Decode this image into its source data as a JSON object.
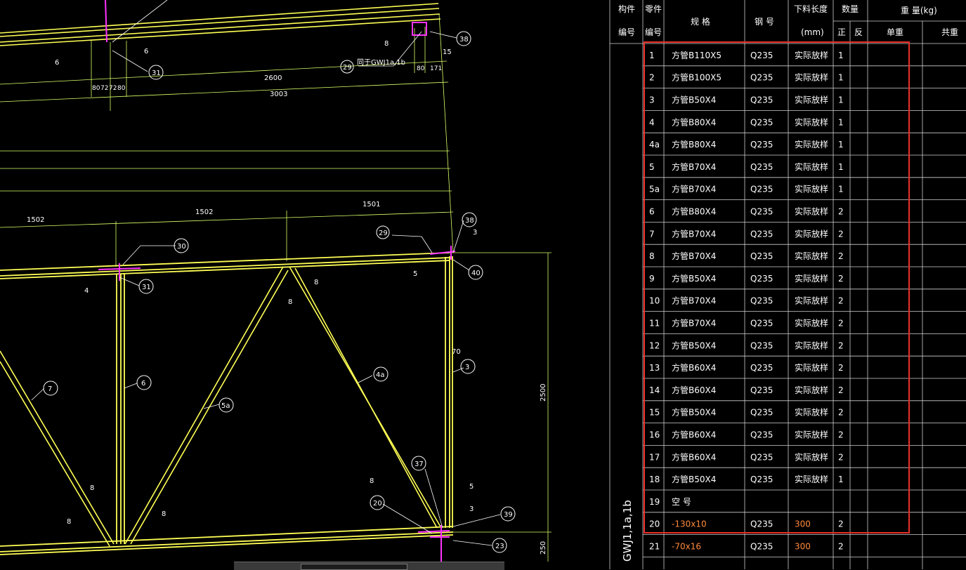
{
  "table": {
    "header": {
      "member_no": [
        "构件",
        "编号"
      ],
      "part_no": [
        "零件",
        "编号"
      ],
      "spec": "规  格",
      "steel": "钢  号",
      "cut_length": [
        "下料长度",
        "(mm)"
      ],
      "quantity": "数量",
      "qty_front": "正",
      "qty_back": "反",
      "weight": "重  量(kg)",
      "unit_weight": "单重",
      "total_weight": "共重"
    },
    "member_id": "GWJ1,1a,1b",
    "rows": [
      {
        "no": "1",
        "spec": "方管B110X5",
        "steel": "Q235",
        "length": "实际放样",
        "qty": "1"
      },
      {
        "no": "2",
        "spec": "方管B100X5",
        "steel": "Q235",
        "length": "实际放样",
        "qty": "1"
      },
      {
        "no": "3",
        "spec": "方管B50X4",
        "steel": "Q235",
        "length": "实际放样",
        "qty": "1"
      },
      {
        "no": "4",
        "spec": "方管B80X4",
        "steel": "Q235",
        "length": "实际放样",
        "qty": "1"
      },
      {
        "no": "4a",
        "spec": "方管B80X4",
        "steel": "Q235",
        "length": "实际放样",
        "qty": "1"
      },
      {
        "no": "5",
        "spec": "方管B70X4",
        "steel": "Q235",
        "length": "实际放样",
        "qty": "1"
      },
      {
        "no": "5a",
        "spec": "方管B70X4",
        "steel": "Q235",
        "length": "实际放样",
        "qty": "1"
      },
      {
        "no": "6",
        "spec": "方管B80X4",
        "steel": "Q235",
        "length": "实际放样",
        "qty": "2"
      },
      {
        "no": "7",
        "spec": "方管B70X4",
        "steel": "Q235",
        "length": "实际放样",
        "qty": "2"
      },
      {
        "no": "8",
        "spec": "方管B70X4",
        "steel": "Q235",
        "length": "实际放样",
        "qty": "2"
      },
      {
        "no": "9",
        "spec": "方管B50X4",
        "steel": "Q235",
        "length": "实际放样",
        "qty": "2"
      },
      {
        "no": "10",
        "spec": "方管B70X4",
        "steel": "Q235",
        "length": "实际放样",
        "qty": "2"
      },
      {
        "no": "11",
        "spec": "方管B70X4",
        "steel": "Q235",
        "length": "实际放样",
        "qty": "2"
      },
      {
        "no": "12",
        "spec": "方管B50X4",
        "steel": "Q235",
        "length": "实际放样",
        "qty": "2"
      },
      {
        "no": "13",
        "spec": "方管B60X4",
        "steel": "Q235",
        "length": "实际放样",
        "qty": "2"
      },
      {
        "no": "14",
        "spec": "方管B60X4",
        "steel": "Q235",
        "length": "实际放样",
        "qty": "2"
      },
      {
        "no": "15",
        "spec": "方管B50X4",
        "steel": "Q235",
        "length": "实际放样",
        "qty": "2"
      },
      {
        "no": "16",
        "spec": "方管B60X4",
        "steel": "Q235",
        "length": "实际放样",
        "qty": "2"
      },
      {
        "no": "17",
        "spec": "方管B60X4",
        "steel": "Q235",
        "length": "实际放样",
        "qty": "2"
      },
      {
        "no": "18",
        "spec": "方管B50X4",
        "steel": "Q235",
        "length": "实际放样",
        "qty": "1"
      },
      {
        "no": "19",
        "spec": "空  号",
        "steel": "",
        "length": "",
        "qty": ""
      },
      {
        "no": "20",
        "spec": "-130x10",
        "steel": "Q235",
        "length": "300",
        "qty": "2",
        "highlight": true
      },
      {
        "no": "21",
        "spec": "-70x16",
        "steel": "Q235",
        "length": "300",
        "qty": "2",
        "highlight": true
      }
    ]
  },
  "drawing": {
    "dimensions": [
      "2600",
      "3003",
      "1502",
      "1502",
      "1501",
      "2500",
      "250",
      "70",
      "15",
      "80",
      "72",
      "72",
      "80",
      "80",
      "171"
    ],
    "callouts": [
      "31",
      "38",
      "29",
      "30",
      "31",
      "38",
      "40",
      "6",
      "7",
      "5a",
      "4a",
      "3",
      "37",
      "20",
      "39",
      "23"
    ],
    "weld_marks": [
      "6",
      "8",
      "4",
      "8",
      "8",
      "5",
      "3",
      "8",
      "8",
      "8",
      "8",
      "5",
      "3",
      "5"
    ],
    "note": "同于GWJ1a,1b"
  },
  "colors": {
    "background": "#000000",
    "member_lines": "#ffff55",
    "dimension_lines": "#d8ff66",
    "highlight_nodes": "#ff33ff",
    "selection_box": "#e8302a",
    "table_grid": "#cfcfcf",
    "orange_text": "#ff8a3c"
  }
}
